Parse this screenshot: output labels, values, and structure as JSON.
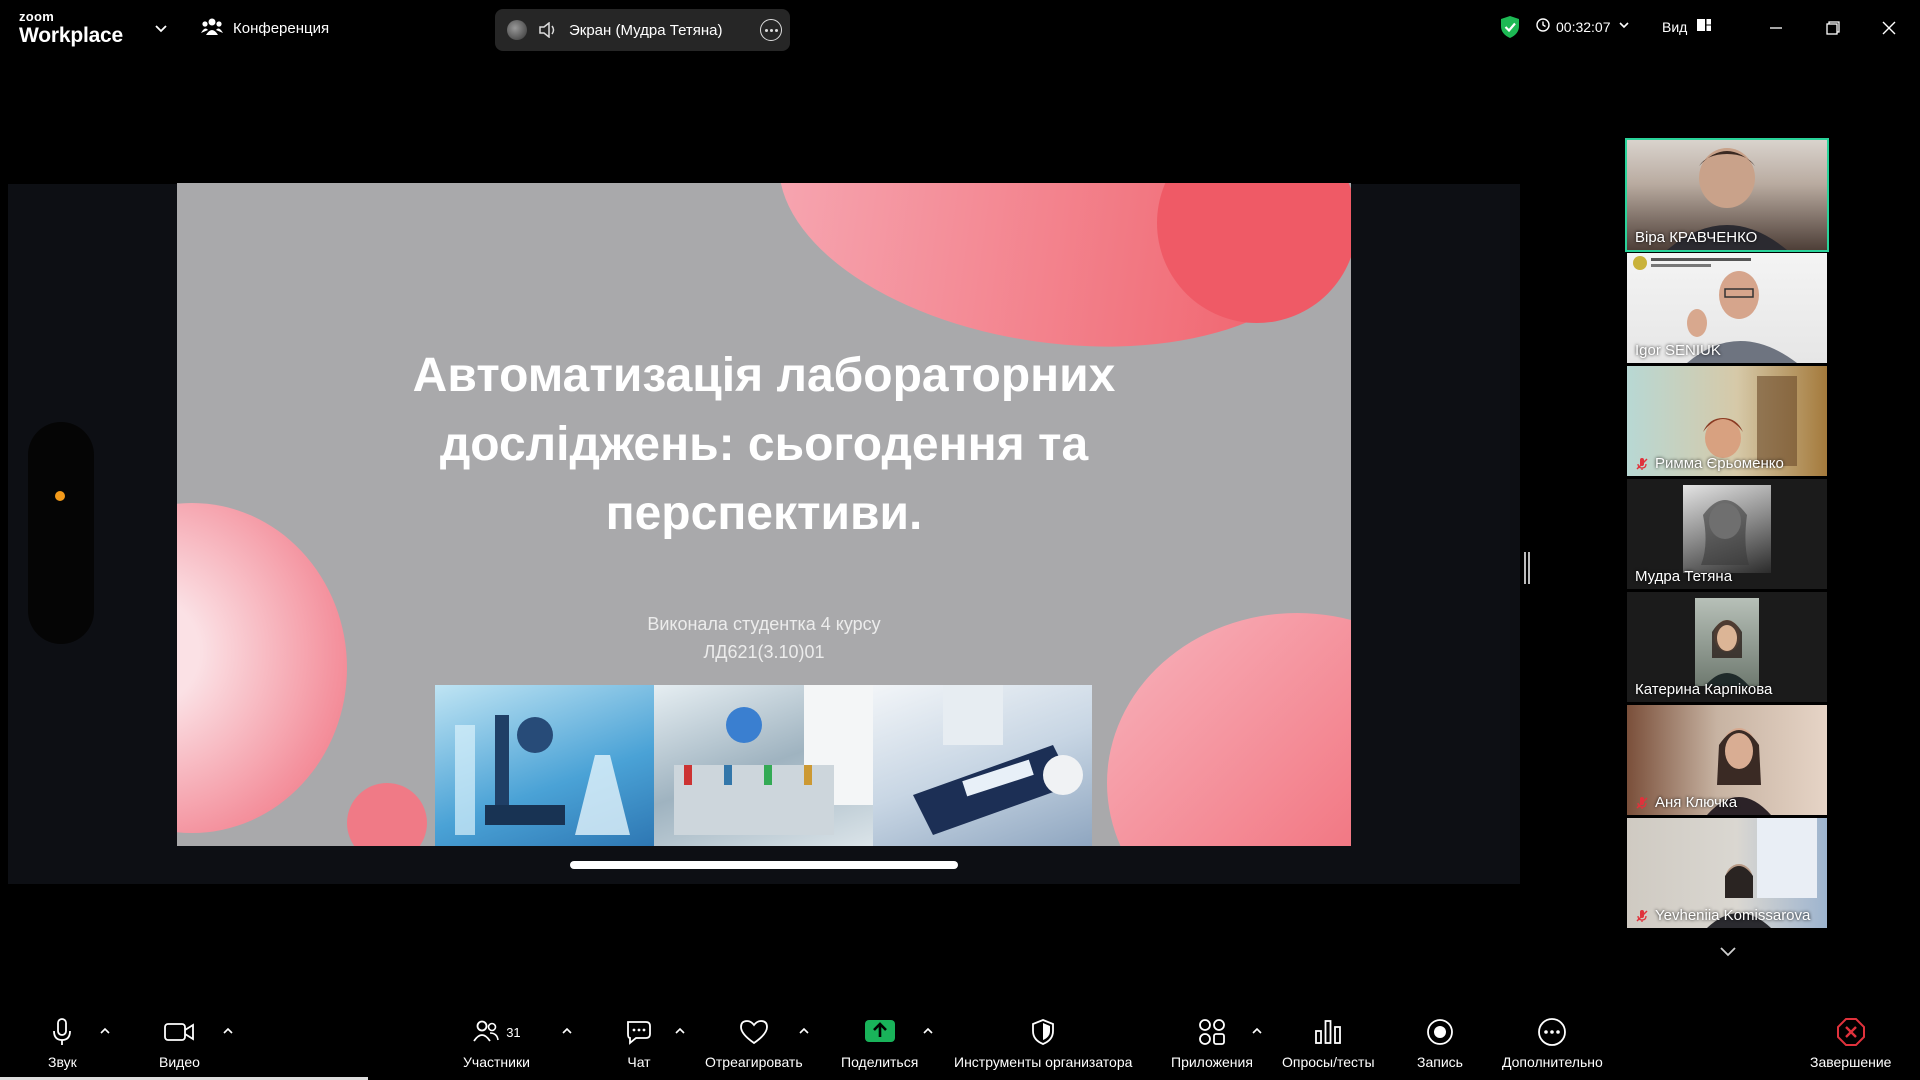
{
  "app": {
    "brand_small": "zoom",
    "brand_large": "Workplace"
  },
  "header": {
    "meeting_label": "Конференция",
    "screen_share_label": "Экран (Мудра Тетяна)",
    "timer": "00:32:07",
    "view_label": "Вид"
  },
  "slide": {
    "title_lines": [
      "Автоматизація лабораторних",
      "досліджень: сьогодення та",
      "перспективи."
    ],
    "subtitle_lines": [
      "Виконала студентка 4 курсу",
      "ЛД621(3.10)01"
    ]
  },
  "participants": [
    {
      "name": "Віра КРАВЧЕНКО",
      "muted": false,
      "active": true
    },
    {
      "name": "Igor SENIUK",
      "muted": false,
      "active": false
    },
    {
      "name": "Римма Єрьоменко",
      "muted": true,
      "active": false
    },
    {
      "name": "Мудра Тетяна",
      "muted": false,
      "active": false
    },
    {
      "name": "Катерина Карпікова",
      "muted": false,
      "active": false
    },
    {
      "name": "Аня Ключка",
      "muted": true,
      "active": false
    },
    {
      "name": "Yevheniia Komissarova",
      "muted": true,
      "active": false
    }
  ],
  "toolbar": {
    "audio": "Звук",
    "video": "Видео",
    "participants": "Участники",
    "participants_count": "31",
    "chat": "Чат",
    "react": "Отреагировать",
    "share": "Поделиться",
    "host_tools": "Инструменты организатора",
    "apps": "Приложения",
    "polls": "Опросы/тесты",
    "record": "Запись",
    "more": "Дополнительно",
    "end": "Завершение"
  },
  "colors": {
    "active_speaker": "#2ad39a",
    "share_green": "#19b35a",
    "end_red": "#e0323c",
    "encryption_green": "#1db954"
  }
}
